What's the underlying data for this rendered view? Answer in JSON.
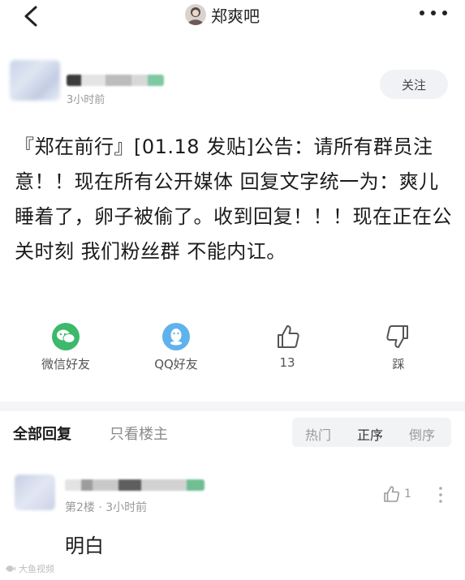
{
  "topbar": {
    "forum_name": "郑爽吧",
    "back_icon": "chevron-left-icon",
    "more_icon": "more-dots-icon"
  },
  "post": {
    "time": "3小时前",
    "follow_label": "关注",
    "text": "『郑在前行』[01.18 发贴]公告：请所有群员注意！！现在所有公开媒体 回复文字统一为：爽儿睡着了，卵子被偷了。收到回复！！！现在正在公关时刻 我们粉丝群 不能内讧。"
  },
  "actions": {
    "wechat_label": "微信好友",
    "qq_label": "QQ好友",
    "like_count": "13",
    "dislike_label": "踩",
    "colors": {
      "wechat": "#3cb96a",
      "qq": "#5fb2ec"
    }
  },
  "replies_header": {
    "all_label": "全部回复",
    "op_only_label": "只看楼主",
    "sort_hot": "热门",
    "sort_asc": "正序",
    "sort_desc": "倒序"
  },
  "reply": {
    "meta": "第2楼 · 3小时前",
    "like_count": "1",
    "text": "明白"
  },
  "watermark": {
    "text": "大鱼视频"
  }
}
